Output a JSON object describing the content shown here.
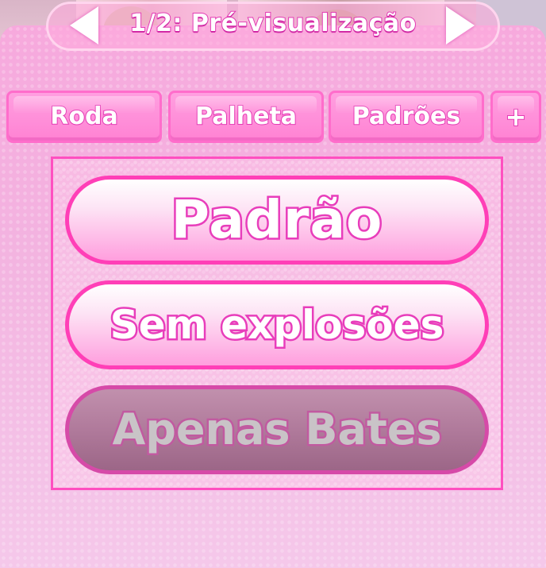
{
  "preview": {
    "title": "1/2: Pré-visualização",
    "prev_icon": "arrow-left-icon",
    "next_icon": "arrow-right-icon"
  },
  "tabs": [
    {
      "label": "Roda"
    },
    {
      "label": "Palheta"
    },
    {
      "label": "Padrões"
    },
    {
      "label": "+"
    }
  ],
  "options": [
    {
      "label": "Padrão",
      "state": "enabled"
    },
    {
      "label": "Sem explosões",
      "state": "enabled"
    },
    {
      "label": "Apenas Bates",
      "state": "disabled"
    }
  ],
  "colors": {
    "accent": "#ff3fb7",
    "panel": "#f7a9dd",
    "disabled": "#b07a9b"
  }
}
